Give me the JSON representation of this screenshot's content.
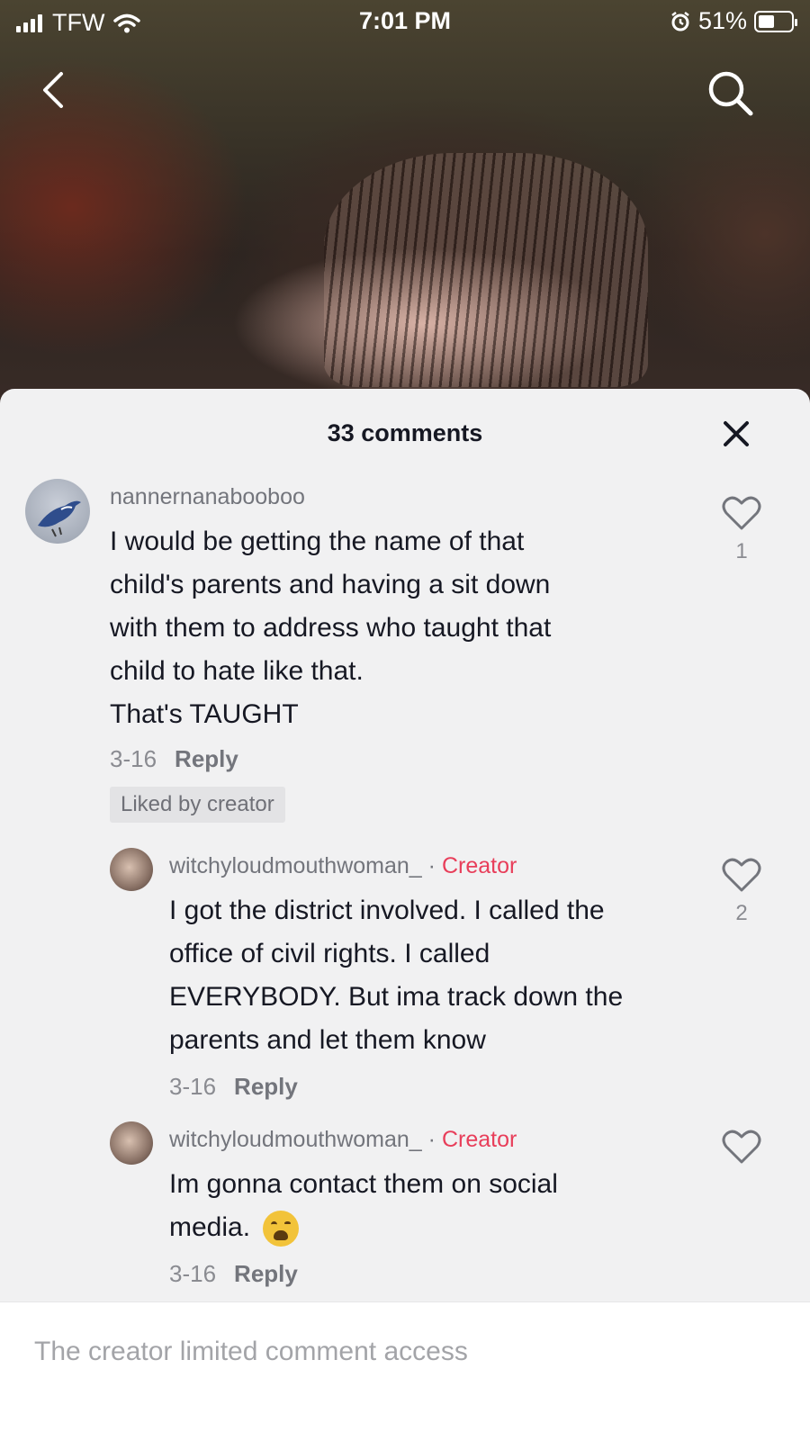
{
  "status_bar": {
    "carrier": "TFW",
    "time": "7:01 PM",
    "battery": "51%"
  },
  "nav": {
    "back_icon": "chevron-left-icon",
    "search_icon": "search-icon"
  },
  "sheet": {
    "title": "33 comments",
    "close_icon": "close-icon"
  },
  "comments": [
    {
      "username": "nannernanabooboo",
      "lines": [
        "I would be getting the name of that",
        "child's parents and having a sit down",
        "with them to address who taught that",
        "child to hate like that.",
        "That's TAUGHT"
      ],
      "date": "3-16",
      "reply_label": "Reply",
      "liked_badge": "Liked by creator",
      "like_count": "1"
    }
  ],
  "replies": [
    {
      "username": "witchyloudmouthwoman_",
      "separator": "·",
      "tag": "Creator",
      "lines": [
        "I got the district involved. I called the",
        "office of civil rights. I called",
        "EVERYBODY. But ima track down the",
        "parents and let them know"
      ],
      "date": "3-16",
      "reply_label": "Reply",
      "like_count": "2"
    },
    {
      "username": "witchyloudmouthwoman_",
      "separator": "·",
      "tag": "Creator",
      "lines": [
        "Im gonna contact them on social",
        "media."
      ],
      "emoji": "weary-face-emoji",
      "date": "3-16",
      "reply_label": "Reply"
    }
  ],
  "footer": {
    "notice": "The creator limited comment access"
  },
  "colors": {
    "creator_tag": "#e83e5a",
    "sheet_bg": "#f1f1f2",
    "text": "#161823",
    "muted": "#8a8b91"
  }
}
